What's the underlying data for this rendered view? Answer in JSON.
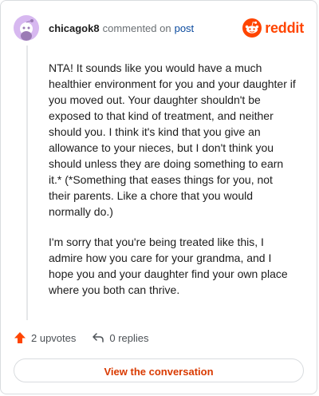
{
  "header": {
    "username": "chicagok8",
    "commented_text": "commented on",
    "post_link": "post",
    "brand": "reddit"
  },
  "comment": {
    "paragraphs": [
      "NTA! It sounds like you would have a much healthier environment for you and your daughter if you moved out. Your daughter shouldn't be exposed to that kind of treatment, and neither should you. I think it's kind that you give an allowance to your nieces, but I don't think you should unless they are doing something to earn it.* (*Something that eases things for you, not their parents. Like a chore that you would normally do.)",
      "I'm sorry that you're being treated like this, I admire how you care for your grandma, and I hope you and your daughter find your own place where you both can thrive."
    ]
  },
  "actions": {
    "upvotes": "2 upvotes",
    "replies": "0 replies"
  },
  "cta": {
    "label": "View the conversation"
  },
  "colors": {
    "brand": "#ff4500",
    "link": "#0a4a9e",
    "cta_text": "#d93a00",
    "avatar_bg": "#d7b8f0"
  },
  "icons": {
    "avatar": "snoo-avatar-icon",
    "brand": "reddit-logo-icon",
    "upvote": "upvote-arrow-icon",
    "reply": "reply-arrow-icon"
  }
}
